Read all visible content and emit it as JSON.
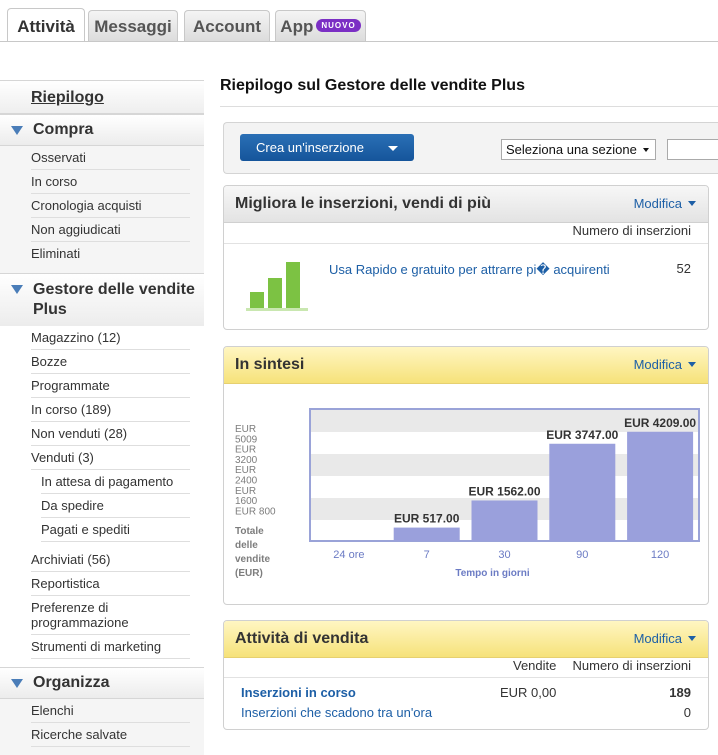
{
  "tabs": [
    {
      "label": "Attività"
    },
    {
      "label": "Messaggi"
    },
    {
      "label": "Account"
    },
    {
      "label": "App",
      "badge": "NUOVO"
    }
  ],
  "sidebar": {
    "summary": "Riepilogo",
    "buy": {
      "title": "Compra",
      "items": [
        "Osservati",
        "In corso",
        "Cronologia acquisti",
        "Non aggiudicati",
        "Eliminati"
      ]
    },
    "sell": {
      "title_line1": "Gestore delle vendite",
      "title_line2": "Plus",
      "items": [
        "Magazzino",
        "Bozze",
        "Programmate",
        "In corso",
        "Non venduti",
        "Venduti"
      ],
      "counts": [
        "(12)",
        "(189)",
        "(28)",
        "(3)"
      ],
      "sold_sub": [
        "In attesa di pagamento",
        "Da spedire",
        "Pagati e spediti"
      ],
      "more": [
        "Archiviati",
        "Reportistica",
        "Preferenze di",
        "programmazione",
        "Strumenti di marketing"
      ],
      "archived_count": "(56)"
    },
    "organize": {
      "title": "Organizza",
      "items": [
        "Elenchi",
        "Ricerche salvate"
      ]
    }
  },
  "main": {
    "title": "Riepilogo sul Gestore delle vendite Plus",
    "create_label": "Crea un'inserzione",
    "section_select": "Seleziona una sezione",
    "improve": {
      "title": "Migliora le inserzioni, vendi di più",
      "edit": "Modifica",
      "col": "Numero di inserzioni",
      "link": "Usa Rapido e gratuito per attrarre pi� acquirenti",
      "count": "52"
    },
    "summary": {
      "title": "In sintesi",
      "edit": "Modifica",
      "ylabels": [
        "EUR",
        "5009",
        "EUR",
        "3200",
        "EUR",
        "2400",
        "EUR",
        "1600",
        "EUR 800"
      ],
      "total_label": [
        "Totale",
        "delle",
        "vendite",
        "(EUR)"
      ],
      "xlabel": "Tempo in giorni"
    },
    "activity": {
      "title": "Attività di vendita",
      "edit": "Modifica",
      "col_sales": "Vendite",
      "col_count": "Numero di inserzioni",
      "rows": [
        {
          "label": "Inserzioni in corso",
          "sales": "EUR 0,00",
          "count": "189"
        },
        {
          "label": "Inserzioni che scadono tra un'ora",
          "sales": "",
          "count": "0"
        }
      ]
    }
  },
  "chart_data": {
    "type": "bar",
    "categories": [
      "24 ore",
      "7",
      "30",
      "90",
      "120"
    ],
    "values": [
      0,
      517.0,
      1562.0,
      3747.0,
      4209.0
    ],
    "labels": [
      "",
      "EUR 517.00",
      "EUR 1562.00",
      "EUR 3747.00",
      "EUR 4209.00"
    ],
    "xlabel": "Tempo in giorni",
    "ylim": [
      0,
      5009
    ],
    "bar_color": "#9aa0dc"
  }
}
